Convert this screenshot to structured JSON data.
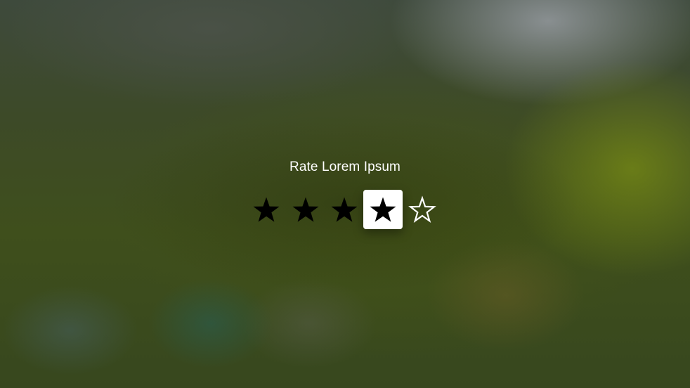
{
  "rating": {
    "title": "Rate Lorem Ipsum",
    "value": 4,
    "max": 5,
    "focused_star": 4,
    "star_icon": "star-icon",
    "colors": {
      "filled_star": "#000000",
      "empty_star_outline": "#ffffff",
      "focus_background": "#ffffff",
      "title_text": "#ffffff"
    }
  }
}
